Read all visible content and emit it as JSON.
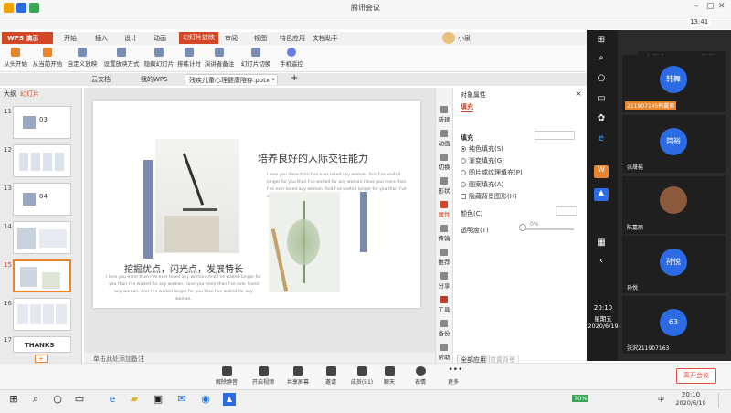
{
  "window": {
    "title": "腾讯会议",
    "time_badge": "13:41"
  },
  "share_toolbar": {
    "user": "小泉"
  },
  "wps": {
    "app_label": "WPS 演示",
    "menu": [
      "开始",
      "插入",
      "设计",
      "动画",
      "幻灯片放映",
      "审阅",
      "视图",
      "特色应用",
      "文档助手"
    ],
    "active_menu": "幻灯片放映",
    "ribbon": [
      "从头开始",
      "从当前开始",
      "自定义放映",
      "设置放映方式",
      "隐藏幻灯片",
      "排练计时",
      "演讲者备注",
      "幻灯片切换",
      "手机遥控"
    ],
    "tabs": [
      "云文档",
      "我的WPS",
      "残疾儿童心理健康陪存.pptx *"
    ],
    "panel_tabs": [
      "大纲",
      "幻灯片"
    ],
    "thumb_numbers": [
      "11",
      "12",
      "13",
      "14",
      "15",
      "16",
      "17"
    ],
    "thumb_last_text": "THANKS",
    "slide": {
      "title": "培养良好的人际交往能力",
      "subtitle": "挖掘优点，闪光点，发展特长",
      "body": "I love you more than I've ever loved any woman. And I've waited longer for you than I've waited for any woman.I love you more than I've ever loved any woman. And I've waited longer for you than I've waited for any woman.",
      "body2": "I love you more than I've ever loved any woman. And I've waited longer for you than I've waited for any woman.I love you more than I've ever loved any woman. And I've waited longer for you than I've waited for any woman."
    },
    "note_placeholder": "单击此处添加备注",
    "right_tools": [
      "新建",
      "动画",
      "切换",
      "形状",
      "属性",
      "传输",
      "推荐",
      "分享",
      "工具",
      "备份",
      "帮助"
    ],
    "props": {
      "header": "对象属性",
      "tab": "填充",
      "section": "填充",
      "options": [
        "纯色填充(S)",
        "渐变填充(G)",
        "图片或纹理填充(P)",
        "图案填充(A)",
        "隐藏背景图形(H)"
      ],
      "color_label": "颜色(C)",
      "transparency_label": "透明度(T)",
      "transparency_value": "0%",
      "apply_all": "全部应用",
      "reset_bg": "重置背景"
    }
  },
  "participants": {
    "speaking": "正在讲话: 211907145韩戴舞;",
    "list": [
      {
        "avatar": "韩舞",
        "name": "211907145韩戴舞",
        "color": "#2d6be4"
      },
      {
        "avatar": "简裕",
        "name": "张晟裕",
        "color": "#2d6be4"
      },
      {
        "avatar": "",
        "name": "陈嘉丽",
        "color": "#8b5a3c"
      },
      {
        "avatar": "孙悦",
        "name": "孙悦",
        "color": "#2d6be4"
      },
      {
        "avatar": "63",
        "name": "张沢211907163",
        "color": "#2d6be4"
      }
    ]
  },
  "inner_clock": {
    "time": "20:10",
    "weekday": "星期五",
    "date": "2020/6/19"
  },
  "meeting_bar": {
    "buttons": [
      "解除静音",
      "开启视频",
      "共享屏幕",
      "邀请",
      "成员(51)",
      "聊天",
      "表情",
      "更多"
    ],
    "leave": "离开会议"
  },
  "taskbar": {
    "battery": "70%",
    "ime": "中",
    "time": "20:10",
    "date": "2020/6/19"
  }
}
